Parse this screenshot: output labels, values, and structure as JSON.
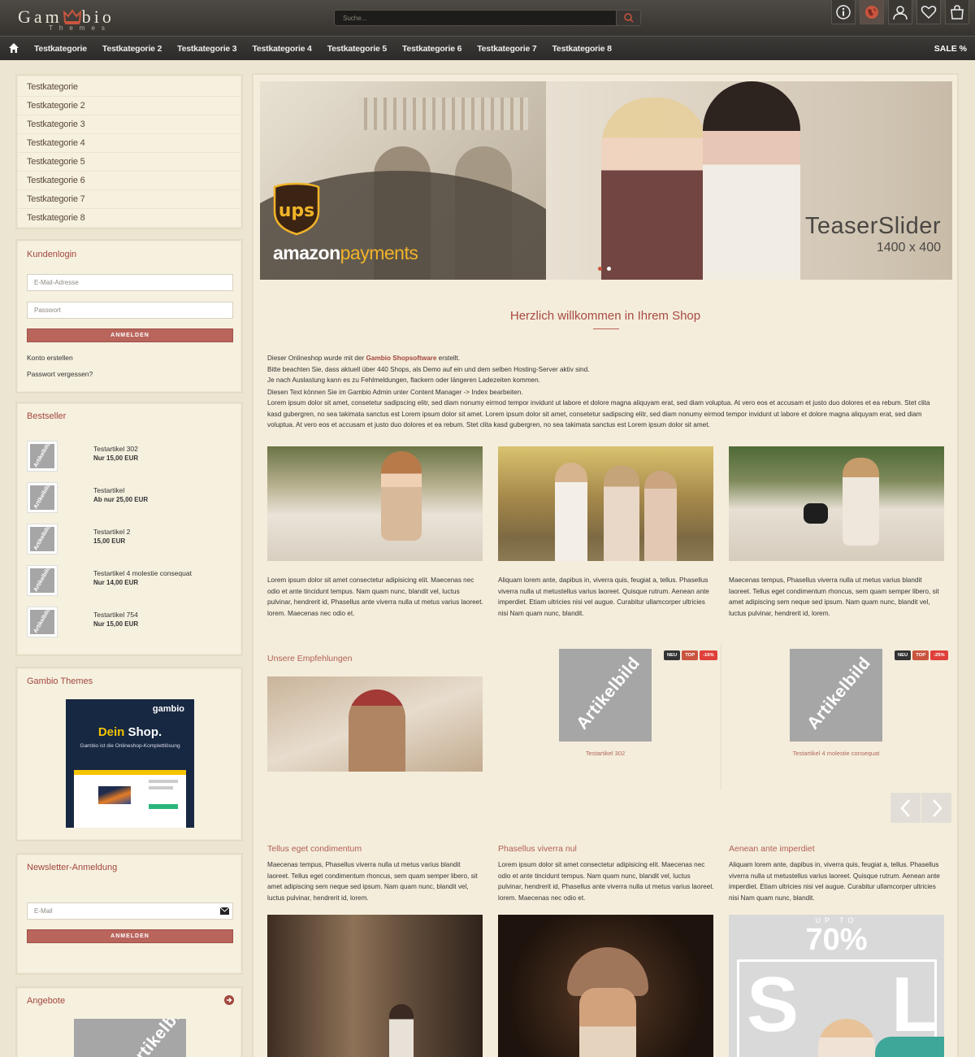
{
  "header": {
    "logo_text_left": "Gam",
    "logo_text_right": "bio",
    "logo_sub": "Themes",
    "search_placeholder": "Suche...",
    "icons": [
      "info-icon",
      "globe-icon",
      "user-icon",
      "heart-icon",
      "shopping-bag-icon"
    ]
  },
  "nav": {
    "items": [
      "Testkategorie",
      "Testkategorie 2",
      "Testkategorie 3",
      "Testkategorie 4",
      "Testkategorie 5",
      "Testkategorie 6",
      "Testkategorie 7",
      "Testkategorie 8"
    ],
    "sale": "SALE %"
  },
  "sidebar": {
    "categories": [
      "Testkategorie",
      "Testkategorie 2",
      "Testkategorie 3",
      "Testkategorie 4",
      "Testkategorie 5",
      "Testkategorie 6",
      "Testkategorie 7",
      "Testkategorie 8"
    ],
    "login": {
      "title": "Kundenlogin",
      "email_placeholder": "E-Mail-Adresse",
      "password_placeholder": "Passwort",
      "button": "ANMELDEN",
      "create_account": "Konto erstellen",
      "forgot_password": "Passwort vergessen?"
    },
    "bestseller": {
      "title": "Bestseller",
      "thumb_label": "Artikelbild",
      "items": [
        {
          "name": "Testartikel 302",
          "price": "Nur 15,00 EUR"
        },
        {
          "name": "Testartikel",
          "price": "Ab nur 25,00 EUR"
        },
        {
          "name": "Testartikel 2",
          "price": "15,00 EUR"
        },
        {
          "name": "Testartikel 4 molestie consequat",
          "price": "Nur 14,00 EUR"
        },
        {
          "name": "Testartikel 754",
          "price": "Nur 15,00 EUR"
        }
      ]
    },
    "themes": {
      "title": "Gambio Themes",
      "ad_brand": "gambio",
      "ad_headline_a": "Dein ",
      "ad_headline_b": "Shop.",
      "ad_sub": "Gambio ist die Onlineshop-Komplettlösung"
    },
    "newsletter": {
      "title": "Newsletter-Anmeldung",
      "email_placeholder": "E-Mail",
      "button": "ANMELDEN"
    },
    "offers": {
      "title": "Angebote",
      "image_label": "Artikelbild"
    }
  },
  "hero": {
    "ups_text": "ups",
    "amazon_a": "amazon",
    "amazon_b": "payments",
    "teaser_title": "TeaserSlider",
    "teaser_size": "1400 x 400"
  },
  "content": {
    "welcome": "Herzlich willkommen in Ihrem Shop",
    "intro_line1_a": "Dieser Onlineshop wurde mit der ",
    "intro_line1_link": "Gambio Shopsoftware",
    "intro_line1_b": " erstellt.",
    "intro_line2": "Bitte beachten Sie, dass aktuell über 440 Shops, als Demo auf ein und dem selben Hosting-Server aktiv sind.",
    "intro_line3": "Je nach Auslastung kann es zu Fehlmeldungen, flackern oder längeren Ladezeiten kommen.",
    "intro_line4": "Diesen Text können Sie im Gambio Admin unter Content Manager -> Index bearbeiten.",
    "intro_lorem": "Lorem ipsum dolor sit amet, consetetur sadipscing elitr, sed diam nonumy eirmod tempor invidunt ut labore et dolore magna aliquyam erat, sed diam voluptua. At vero eos et accusam et justo duo dolores et ea rebum. Stet clita kasd gubergren, no sea takimata sanctus est Lorem ipsum dolor sit amet. Lorem ipsum dolor sit amet, consetetur sadipscing elitr, sed diam nonumy eirmod tempor invidunt ut labore et dolore magna aliquyam erat, sed diam voluptua. At vero eos et accusam et justo duo dolores et ea rebum. Stet clita kasd gubergren, no sea takimata sanctus est Lorem ipsum dolor sit amet.",
    "photo_texts": [
      "Lorem ipsum dolor sit amet consectetur adipisicing elit. Maecenas nec odio et ante tincidunt tempus. Nam quam nunc, blandit vel, luctus pulvinar, hendrerit id, Phasellus ante viverra nulla ut metus varius laoreet. lorem. Maecenas nec odio et.",
      "Aliquam lorem ante, dapibus in, viverra quis, feugiat a, tellus. Phasellus viverra nulla ut metustellus varius laoreet. Quisque rutrum. Aenean ante imperdiet. Etiam ultricies nisi vel augue. Curabitur ullamcorper ultricies nisi Nam quam nunc, blandit.",
      "Maecenas tempus, Phasellus viverra nulla ut metus varius blandit laoreet. Tellus eget condimentum rhoncus, sem quam semper libero, sit amet adipiscing sem neque sed ipsum. Nam quam nunc, blandit vel, luctus pulvinar, hendrerit id, lorem."
    ],
    "recommend_title": "Unsere Empfehlungen",
    "products": [
      {
        "name": "Testartikel 302",
        "badges": [
          "NEU",
          "TOP",
          "-16%"
        ],
        "image_label": "Artikelbild"
      },
      {
        "name": "Testartikel 4 molestie consequat",
        "badges": [
          "NEU",
          "TOP",
          "-25%"
        ],
        "image_label": "Artikelbild"
      }
    ],
    "cols": [
      {
        "title": "Tellus eget condimentum",
        "text": "Maecenas tempus, Phasellus viverra nulla ut metus varius blandit laoreet. Tellus eget condimentum rhoncus, sem quam semper libero, sit amet adipiscing sem neque sed ipsum. Nam quam nunc, blandit vel, luctus pulvinar, hendrerit id, lorem."
      },
      {
        "title": "Phasellus viverra nul",
        "text": "Lorem ipsum dolor sit amet consectetur adipisicing elit. Maecenas nec odio et ante tincidunt tempus. Nam quam nunc, blandit vel, luctus pulvinar, hendrerit id, Phasellus ante viverra nulla ut metus varius laoreet. lorem. Maecenas nec odio et."
      },
      {
        "title": "Aenean ante imperdiet",
        "text": "Aliquam lorem ante, dapibus in, viverra quis, feugiat a, tellus. Phasellus viverra nulla ut metustellus varius laoreet. Quisque rutrum. Aenean ante imperdiet. Etiam ultricies nisi vel augue. Curabitur ullamcorper ultricies nisi Nam quam nunc, blandit."
      }
    ],
    "sale_up_to": "UP TO",
    "sale_percent": "70%",
    "sale_letters": [
      "S",
      "L"
    ]
  }
}
